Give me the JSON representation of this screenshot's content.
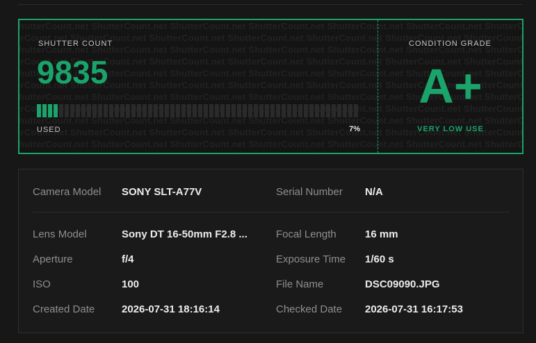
{
  "hero": {
    "shutter_label": "SHUTTER COUNT",
    "count": "9835",
    "used_label": "USED",
    "percent": "7%",
    "used_fraction": 0.07,
    "total_segments": 58,
    "grade_label": "CONDITION GRADE",
    "grade": "A+",
    "grade_desc": "VERY LOW USE",
    "watermark_text": "ShutterCount.net"
  },
  "details": {
    "camera_model_label": "Camera Model",
    "camera_model": "SONY SLT-A77V",
    "serial_label": "Serial Number",
    "serial": "N/A",
    "lens_label": "Lens Model",
    "lens": "Sony DT 16-50mm F2.8 ...",
    "focal_label": "Focal Length",
    "focal": "16 mm",
    "aperture_label": "Aperture",
    "aperture": "f/4",
    "exposure_label": "Exposure Time",
    "exposure": "1/60 s",
    "iso_label": "ISO",
    "iso": "100",
    "filename_label": "File Name",
    "filename": "DSC09090.JPG",
    "created_label": "Created Date",
    "created": "2026-07-31 18:16:14",
    "checked_label": "Checked Date",
    "checked": "2026-07-31 16:17:53"
  },
  "colors": {
    "accent": "#1aa36a",
    "background": "#171717"
  }
}
